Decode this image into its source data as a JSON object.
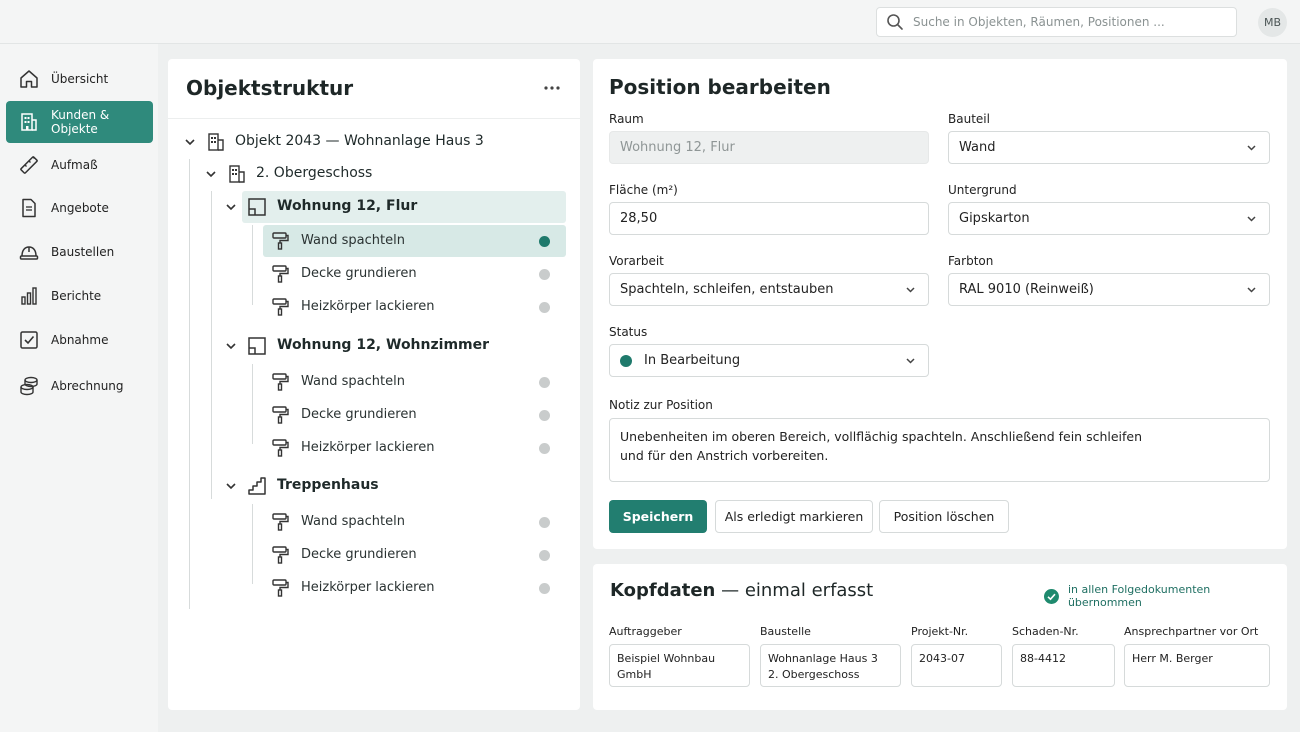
{
  "search": {
    "placeholder": "Suche in Objekten, Räumen, Positionen ..."
  },
  "user": {
    "initials": "MB"
  },
  "sidebar": {
    "items": [
      {
        "label": "Übersicht",
        "icon": "home-icon"
      },
      {
        "label": "Kunden & Objekte",
        "icon": "building-icon",
        "active": true
      },
      {
        "label": "Aufmaß",
        "icon": "ruler-icon"
      },
      {
        "label": "Angebote",
        "icon": "document-icon"
      },
      {
        "label": "Baustellen",
        "icon": "helmet-icon"
      },
      {
        "label": "Berichte",
        "icon": "bar-chart-icon"
      },
      {
        "label": "Abnahme",
        "icon": "checkbox-icon"
      },
      {
        "label": "Abrechnung",
        "icon": "coins-icon"
      }
    ]
  },
  "tree": {
    "title": "Objektstruktur",
    "object": "Objekt 2043  —  Wohnanlage Haus 3",
    "floor": "2. Obergeschoss",
    "rooms": [
      {
        "name": "Wohnung 12, Flur",
        "tasks": [
          "Wand spachteln",
          "Decke grundieren",
          "Heizkörper lackieren"
        ]
      },
      {
        "name": "Wohnung 12, Wohnzimmer",
        "tasks": [
          "Wand spachteln",
          "Decke grundieren",
          "Heizkörper lackieren"
        ]
      },
      {
        "name": "Treppenhaus",
        "tasks": [
          "Wand spachteln",
          "Decke grundieren",
          "Heizkörper lackieren"
        ]
      }
    ]
  },
  "form": {
    "title": "Position bearbeiten",
    "raum_label": "Raum",
    "raum_value": "Wohnung 12, Flur",
    "bauteil_label": "Bauteil",
    "bauteil_value": "Wand",
    "flaeche_label": "Fläche (m²)",
    "flaeche_value": "28,50",
    "untergrund_label": "Untergrund",
    "untergrund_value": "Gipskarton",
    "vorarbeit_label": "Vorarbeit",
    "vorarbeit_value": "Spachteln, schleifen, entstauben",
    "farbton_label": "Farbton",
    "farbton_value": "RAL 9010 (Reinweiß)",
    "status_label": "Status",
    "status_value": "In Bearbeitung",
    "notiz_label": "Notiz zur Position",
    "notiz_line1": "Unebenheiten im oberen Bereich, vollflächig spachteln. Anschließend fein schleifen",
    "notiz_line2": "und für den Anstrich vorbereiten.",
    "save_label": "Speichern",
    "done_label": "Als erledigt markieren",
    "delete_label": "Position löschen"
  },
  "kopf": {
    "title_bold": "Kopfdaten",
    "title_rest": " — einmal erfasst",
    "note": "in allen Folgedokumenten übernommen",
    "auftraggeber_label": "Auftraggeber",
    "auftraggeber_value": "Beispiel Wohnbau GmbH",
    "baustelle_label": "Baustelle",
    "baustelle_line1": "Wohnanlage Haus 3",
    "baustelle_line2": "2. Obergeschoss",
    "projekt_label": "Projekt-Nr.",
    "projekt_value": "2043-07",
    "schaden_label": "Schaden-Nr.",
    "schaden_value": "88-4412",
    "ansprech_label": "Ansprechpartner vor Ort",
    "ansprech_value": "Herr M. Berger"
  },
  "colors": {
    "accent": "#2f8a7c",
    "accent_dark": "#1f7a6c",
    "highlight": "#e3efed"
  }
}
